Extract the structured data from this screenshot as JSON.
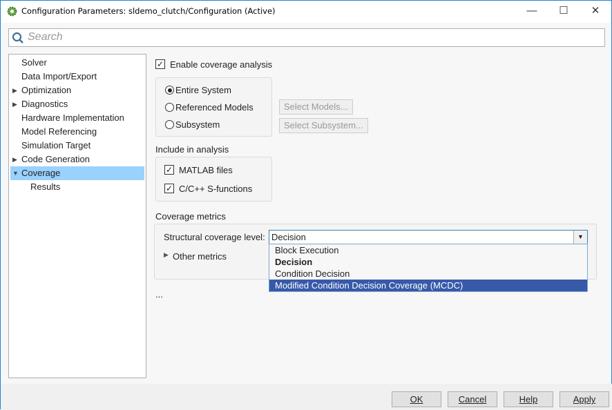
{
  "window": {
    "title": "Configuration Parameters: sldemo_clutch/Configuration (Active)",
    "minimize": "—",
    "maximize": "☐",
    "close": "✕"
  },
  "search": {
    "placeholder": "Search"
  },
  "tree": [
    {
      "label": "Solver",
      "arrow": ""
    },
    {
      "label": "Data Import/Export",
      "arrow": ""
    },
    {
      "label": "Optimization",
      "arrow": "▶"
    },
    {
      "label": "Diagnostics",
      "arrow": "▶"
    },
    {
      "label": "Hardware Implementation",
      "arrow": ""
    },
    {
      "label": "Model Referencing",
      "arrow": ""
    },
    {
      "label": "Simulation Target",
      "arrow": ""
    },
    {
      "label": "Code Generation",
      "arrow": "▶"
    },
    {
      "label": "Coverage",
      "arrow": "▼"
    },
    {
      "label": "Results",
      "arrow": ""
    }
  ],
  "coverage": {
    "enable": {
      "label": "Enable coverage analysis",
      "checked": true
    },
    "scope": [
      {
        "label": "Entire System",
        "selected": true
      },
      {
        "label": "Referenced Models",
        "selected": false
      },
      {
        "label": "Subsystem",
        "selected": false
      }
    ],
    "select_models": "Select Models...",
    "select_subsystem": "Select Subsystem...",
    "include_heading": "Include in analysis",
    "include": [
      {
        "label": "MATLAB files",
        "checked": true
      },
      {
        "label": "C/C++ S-functions",
        "checked": true
      }
    ],
    "metrics_heading": "Coverage metrics",
    "structural_label": "Structural coverage level:",
    "structural_value": "Decision",
    "options": [
      "Block Execution",
      "Decision",
      "Condition Decision",
      "Modified Condition Decision Coverage (MCDC)"
    ],
    "other_metrics": "Other metrics",
    "ellipsis": "..."
  },
  "buttons": {
    "ok": "OK",
    "cancel": "Cancel",
    "help": "Help",
    "apply": "Apply"
  },
  "check_glyph": "✓"
}
